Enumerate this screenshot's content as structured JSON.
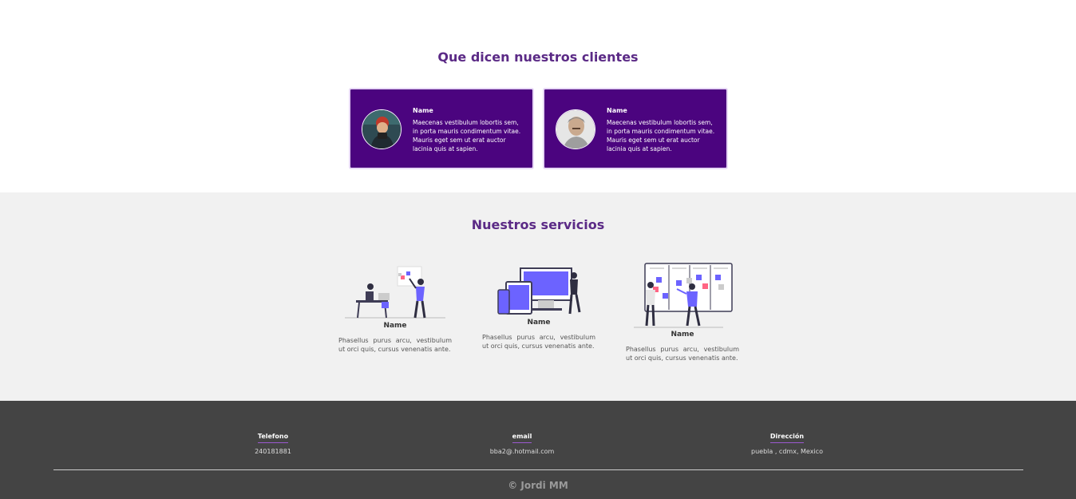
{
  "testimonials": {
    "title": "Que dicen nuestros clientes",
    "cards": [
      {
        "name": "Name",
        "text": "Maecenas vestibulum lobortis sem, in porta mauris condimentum vitae. Mauris eget sem ut erat auctor lacinia quis at sapien."
      },
      {
        "name": "Name",
        "text": "Maecenas vestibulum lobortis sem, in porta mauris condimentum vitae. Mauris eget sem ut erat auctor lacinia quis at sapien."
      }
    ]
  },
  "services": {
    "title": "Nuestros servicios",
    "items": [
      {
        "name": "Name",
        "text": "Phasellus purus arcu, vestibulum ut orci quis, cursus venenatis ante."
      },
      {
        "name": "Name",
        "text": "Phasellus purus arcu, vestibulum ut orci quis, cursus venenatis ante."
      },
      {
        "name": "Name",
        "text": "Phasellus purus arcu, vestibulum ut orci quis, cursus venenatis ante."
      }
    ]
  },
  "footer": {
    "phone_label": "Telefono",
    "phone_value": "240181881",
    "email_label": "email",
    "email_value": "bba2@.hotmail.com",
    "address_label": "Dirección",
    "address_value": "puebla , cdmx, Mexico",
    "copyright": "© Jordi MM"
  },
  "colors": {
    "brand_purple": "#4b047f",
    "title_purple": "#5b2a86",
    "illustration_accent": "#6c63ff",
    "footer_bg": "#444444"
  }
}
